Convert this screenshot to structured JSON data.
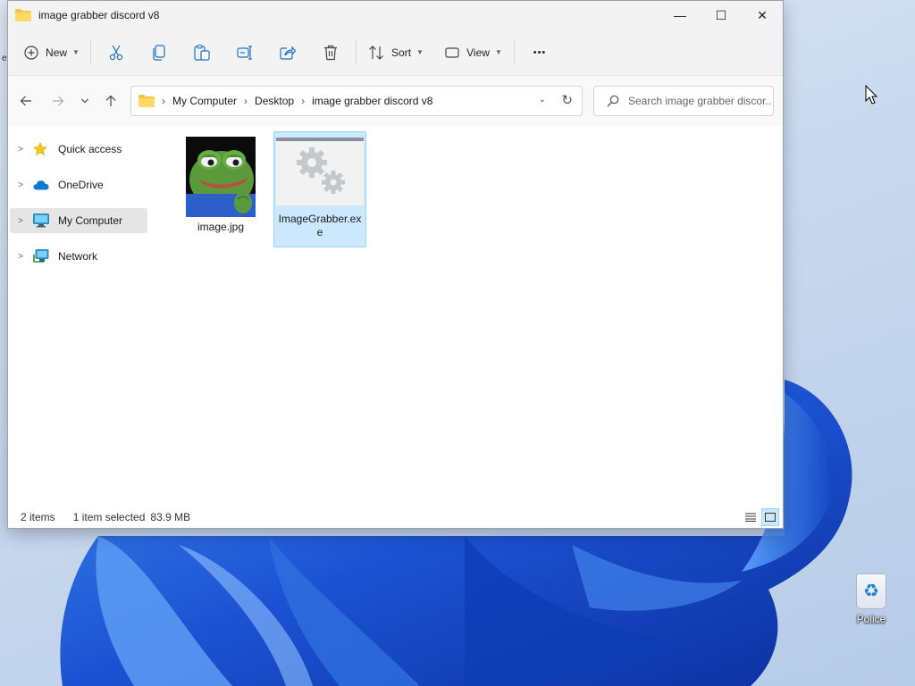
{
  "window": {
    "title": "image grabber discord v8",
    "controls": {
      "minimize": "—",
      "maximize": "☐",
      "close": "✕"
    }
  },
  "toolbar": {
    "new_label": "New",
    "sort_label": "Sort",
    "view_label": "View",
    "more_label": "•••",
    "icons": [
      "add-icon",
      "cut-icon",
      "copy-icon",
      "paste-icon",
      "rename-icon",
      "share-icon",
      "delete-icon",
      "sort-icon",
      "view-icon",
      "more-icon"
    ]
  },
  "addressbar": {
    "breadcrumbs": [
      "My Computer",
      "Desktop",
      "image grabber discord v8"
    ],
    "separator": "›",
    "dropdown": "⌄",
    "refresh": "↻"
  },
  "search": {
    "placeholder": "Search image grabber discor..."
  },
  "sidebar": {
    "items": [
      {
        "label": "Quick access",
        "icon": "star-icon",
        "selected": false
      },
      {
        "label": "OneDrive",
        "icon": "cloud-icon",
        "selected": false
      },
      {
        "label": "My Computer",
        "icon": "monitor-icon",
        "selected": true
      },
      {
        "label": "Network",
        "icon": "network-icon",
        "selected": false
      }
    ]
  },
  "files": [
    {
      "name": "image.jpg",
      "icon": "frog-image-thumbnail",
      "selected": false
    },
    {
      "name": "ImageGrabber.exe",
      "icon": "gear-app-icon",
      "selected": true
    }
  ],
  "status": {
    "count": "2 items",
    "selection": "1 item selected",
    "size": "83.9 MB"
  },
  "desktop": {
    "recycle_bin_label": "Police",
    "colors": {
      "accent": "#0067c0",
      "selection": "#cce8ff",
      "wallpaper_blue": "#1f5fd6"
    }
  }
}
